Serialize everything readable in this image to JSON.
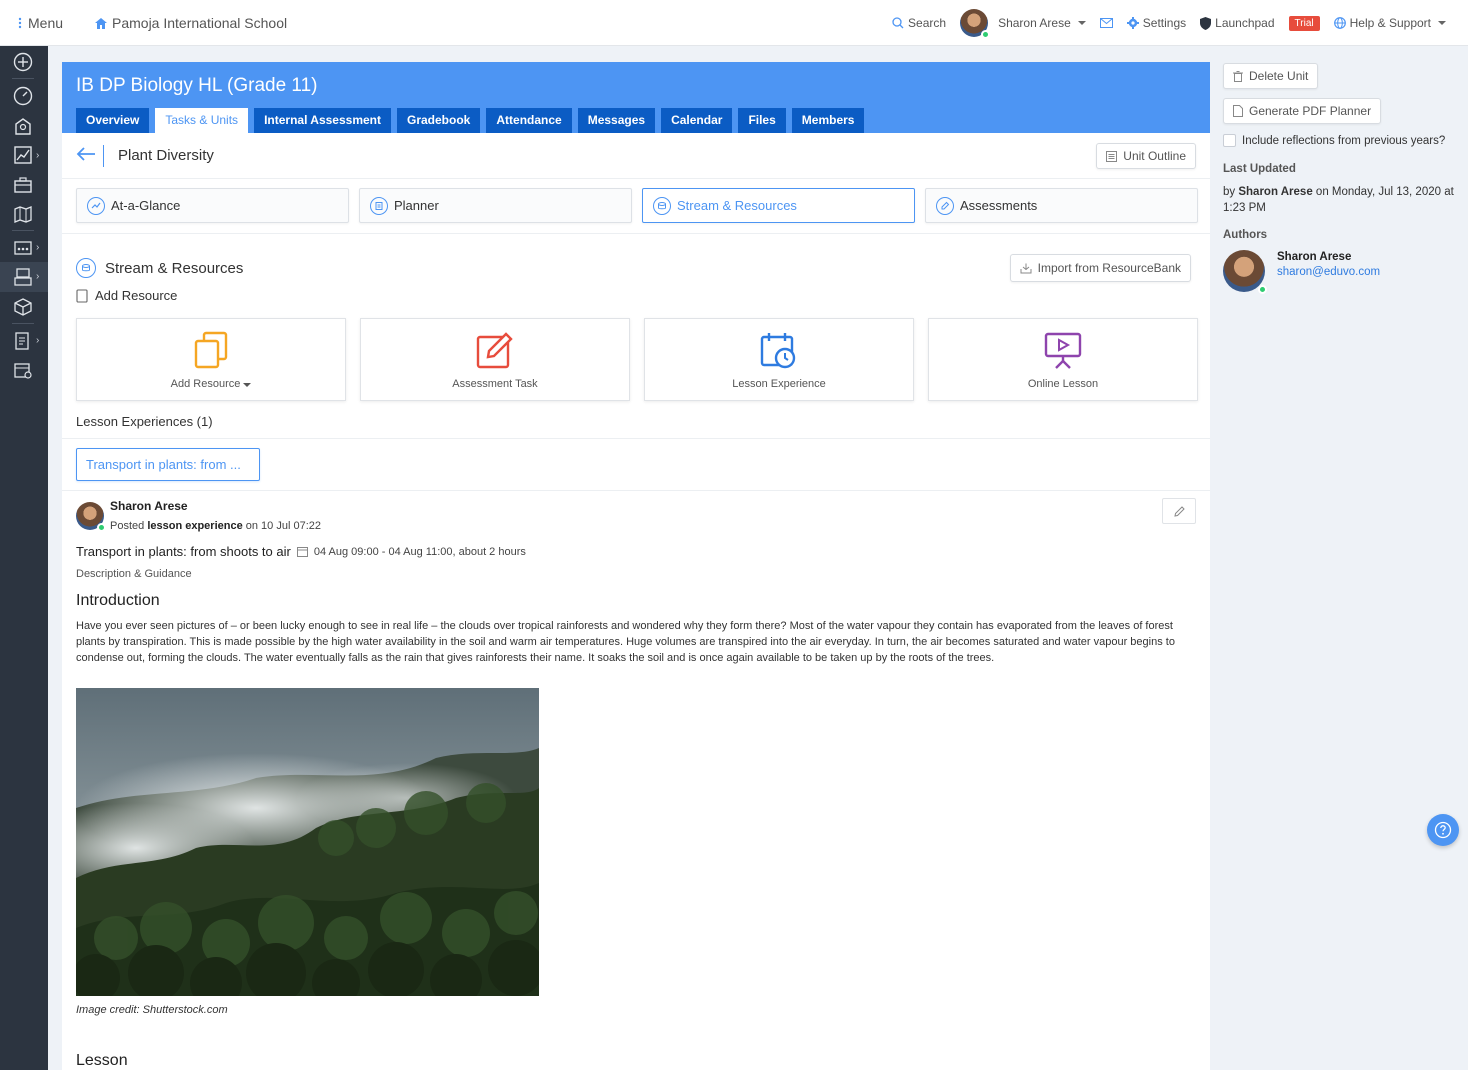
{
  "topbar": {
    "menu_label": "Menu",
    "school_name": "Pamoja International School",
    "search_label": "Search",
    "user_name": "Sharon Arese",
    "settings_label": "Settings",
    "launchpad_label": "Launchpad",
    "trial_badge": "Trial",
    "help_label": "Help & Support"
  },
  "course": {
    "title": "IB DP Biology HL (Grade 11)",
    "tabs": [
      "Overview",
      "Tasks & Units",
      "Internal Assessment",
      "Gradebook",
      "Attendance",
      "Messages",
      "Calendar",
      "Files",
      "Members"
    ],
    "active_tab": "Tasks & Units"
  },
  "unit": {
    "title": "Plant Diversity",
    "outline_button": "Unit Outline"
  },
  "subtabs": [
    "At-a-Glance",
    "Planner",
    "Stream & Resources",
    "Assessments"
  ],
  "stream": {
    "title": "Stream & Resources",
    "import_button": "Import from ResourceBank",
    "add_resource_link": "Add Resource",
    "cards": [
      "Add Resource",
      "Assessment Task",
      "Lesson Experience",
      "Online Lesson"
    ],
    "lesson_experiences_label": "Lesson Experiences (1)",
    "lesson_chip": "Transport in plants: from ..."
  },
  "post": {
    "author": "Sharon Arese",
    "meta_prefix": "Posted",
    "meta_type": "lesson experience",
    "meta_suffix": "on 10 Jul 07:22",
    "title": "Transport in plants: from shoots to air",
    "schedule": "04 Aug 09:00 - 04 Aug 11:00, about 2 hours",
    "description_link": "Description & Guidance",
    "intro_heading": "Introduction",
    "intro_text": "Have you ever seen pictures of – or been lucky enough to see in real life – the clouds over tropical rainforests and wondered why they form there? Most of the water vapour they contain has evaporated from the leaves of forest plants by transpiration. This is made possible by the high water availability in the soil and warm air temperatures. Huge volumes are transpired into the air everyday. In turn, the air becomes saturated and water vapour begins to condense out, forming the clouds. The water eventually falls as the rain that gives rainforests their name. It soaks the soil and is once again available to be taken up by the roots of the trees.",
    "image_credit": "Image credit: Shutterstock.com",
    "lesson_heading": "Lesson"
  },
  "right_panel": {
    "delete_button": "Delete Unit",
    "pdf_button": "Generate PDF Planner",
    "include_reflections": "Include reflections from previous years?",
    "last_updated_label": "Last Updated",
    "updated_by_prefix": "by",
    "updated_by_name": "Sharon Arese",
    "updated_on": "on Monday, Jul 13, 2020 at 1:23 PM",
    "authors_label": "Authors",
    "author_name": "Sharon Arese",
    "author_email": "sharon@eduvo.com"
  },
  "colors": {
    "primary": "#4d95f3",
    "tab_dark": "#0b5cc4",
    "sidebar": "#2c3440",
    "trial": "#e74c3c",
    "card_orange": "#f5a623",
    "card_red": "#e74c3c",
    "card_blue": "#2e7be0",
    "card_purple": "#8e44ad"
  }
}
